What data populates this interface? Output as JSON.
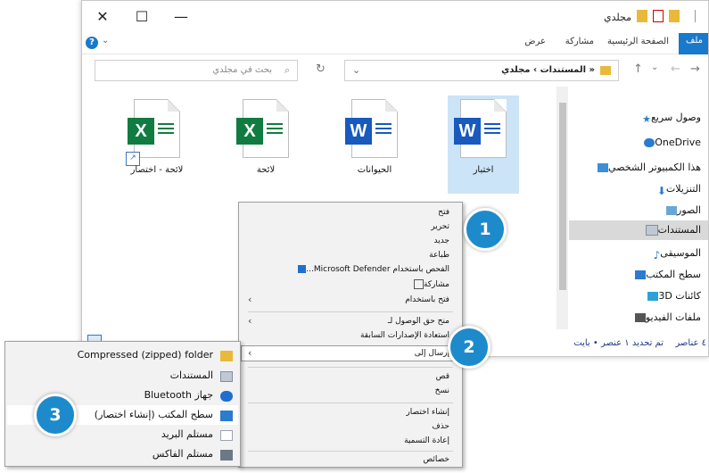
{
  "window": {
    "title": "مجلدي",
    "controls": {
      "close": "✕",
      "maximize": "☐",
      "minimize": "—"
    }
  },
  "ribbon": {
    "tabs": [
      "ملف",
      "الصفحة الرئيسية",
      "مشاركة",
      "عرض"
    ],
    "help": "?"
  },
  "address": {
    "path": "« المستندات › مجلدي",
    "search_placeholder": "بحث في مجلدي"
  },
  "nav": {
    "items": [
      {
        "label": "وصول سريع",
        "icon": "star-icon",
        "color": "#2b7bd0"
      },
      {
        "label": "OneDrive",
        "icon": "cloud-icon",
        "color": "#2b7bd0"
      },
      {
        "label": "هذا الكمبيوتر الشخصي",
        "icon": "computer-icon",
        "color": "#3a8fd8"
      },
      {
        "label": "التنزيلات",
        "icon": "download-icon",
        "color": "#2b7bd0"
      },
      {
        "label": "الصور",
        "icon": "pictures-icon",
        "color": "#6aa6d8"
      },
      {
        "label": "المستندات",
        "icon": "documents-icon",
        "color": "#7f8fa6"
      },
      {
        "label": "الموسيقى",
        "icon": "music-icon",
        "color": "#2b7bd0"
      },
      {
        "label": "سطح المكتب",
        "icon": "desktop-icon",
        "color": "#2b7bd0"
      },
      {
        "label": "كائنات 3D",
        "icon": "cube-icon",
        "color": "#2ba3d8"
      },
      {
        "label": "ملفات الفيديو",
        "icon": "video-icon",
        "color": "#555555"
      }
    ]
  },
  "files": [
    {
      "name": "اختبار",
      "type": "word",
      "badge": "W",
      "selected": true
    },
    {
      "name": "الحيوانات",
      "type": "word",
      "badge": "W",
      "selected": false
    },
    {
      "name": "لائحة",
      "type": "excel",
      "badge": "X",
      "selected": false
    },
    {
      "name": "لائحة - اختصار",
      "type": "excel",
      "badge": "X",
      "selected": false,
      "shortcut": true
    }
  ],
  "status": {
    "items": "٤ عناصر",
    "selection": "تم تحديد ١ عنصر • بايت"
  },
  "context_menu": {
    "items": [
      "فتح",
      "تحرير",
      "جديد",
      "طباعة",
      "الفحص باستخدام Microsoft Defender...",
      "مشاركة",
      "فتح باستخدام",
      "منح حق الوصول لـ",
      "استعادة الإصدارات السابقة",
      "إرسال إلى",
      "قص",
      "نسخ",
      "إنشاء اختصار",
      "حذف",
      "إعادة التسمية",
      "خصائص"
    ],
    "highlighted": "إرسال إلى"
  },
  "sendto_menu": {
    "items": [
      {
        "label": "Compressed (zipped) folder",
        "icon": "zip-folder-icon",
        "color": "#e8b93a"
      },
      {
        "label": "المستندات",
        "icon": "documents-icon",
        "color": "#7f8fa6"
      },
      {
        "label": "جهاز Bluetooth",
        "icon": "bluetooth-icon",
        "color": "#1f6fd1"
      },
      {
        "label": "سطح المكتب (إنشاء اختصار)",
        "icon": "desktop-icon",
        "color": "#2b7bd0"
      },
      {
        "label": "مستلم البريد",
        "icon": "mail-icon",
        "color": "#9aa3ad"
      },
      {
        "label": "مستلم الفاكس",
        "icon": "fax-icon",
        "color": "#6c7885"
      }
    ],
    "highlighted": "سطح المكتب (إنشاء اختصار)"
  },
  "callouts": [
    "1",
    "2",
    "3"
  ]
}
